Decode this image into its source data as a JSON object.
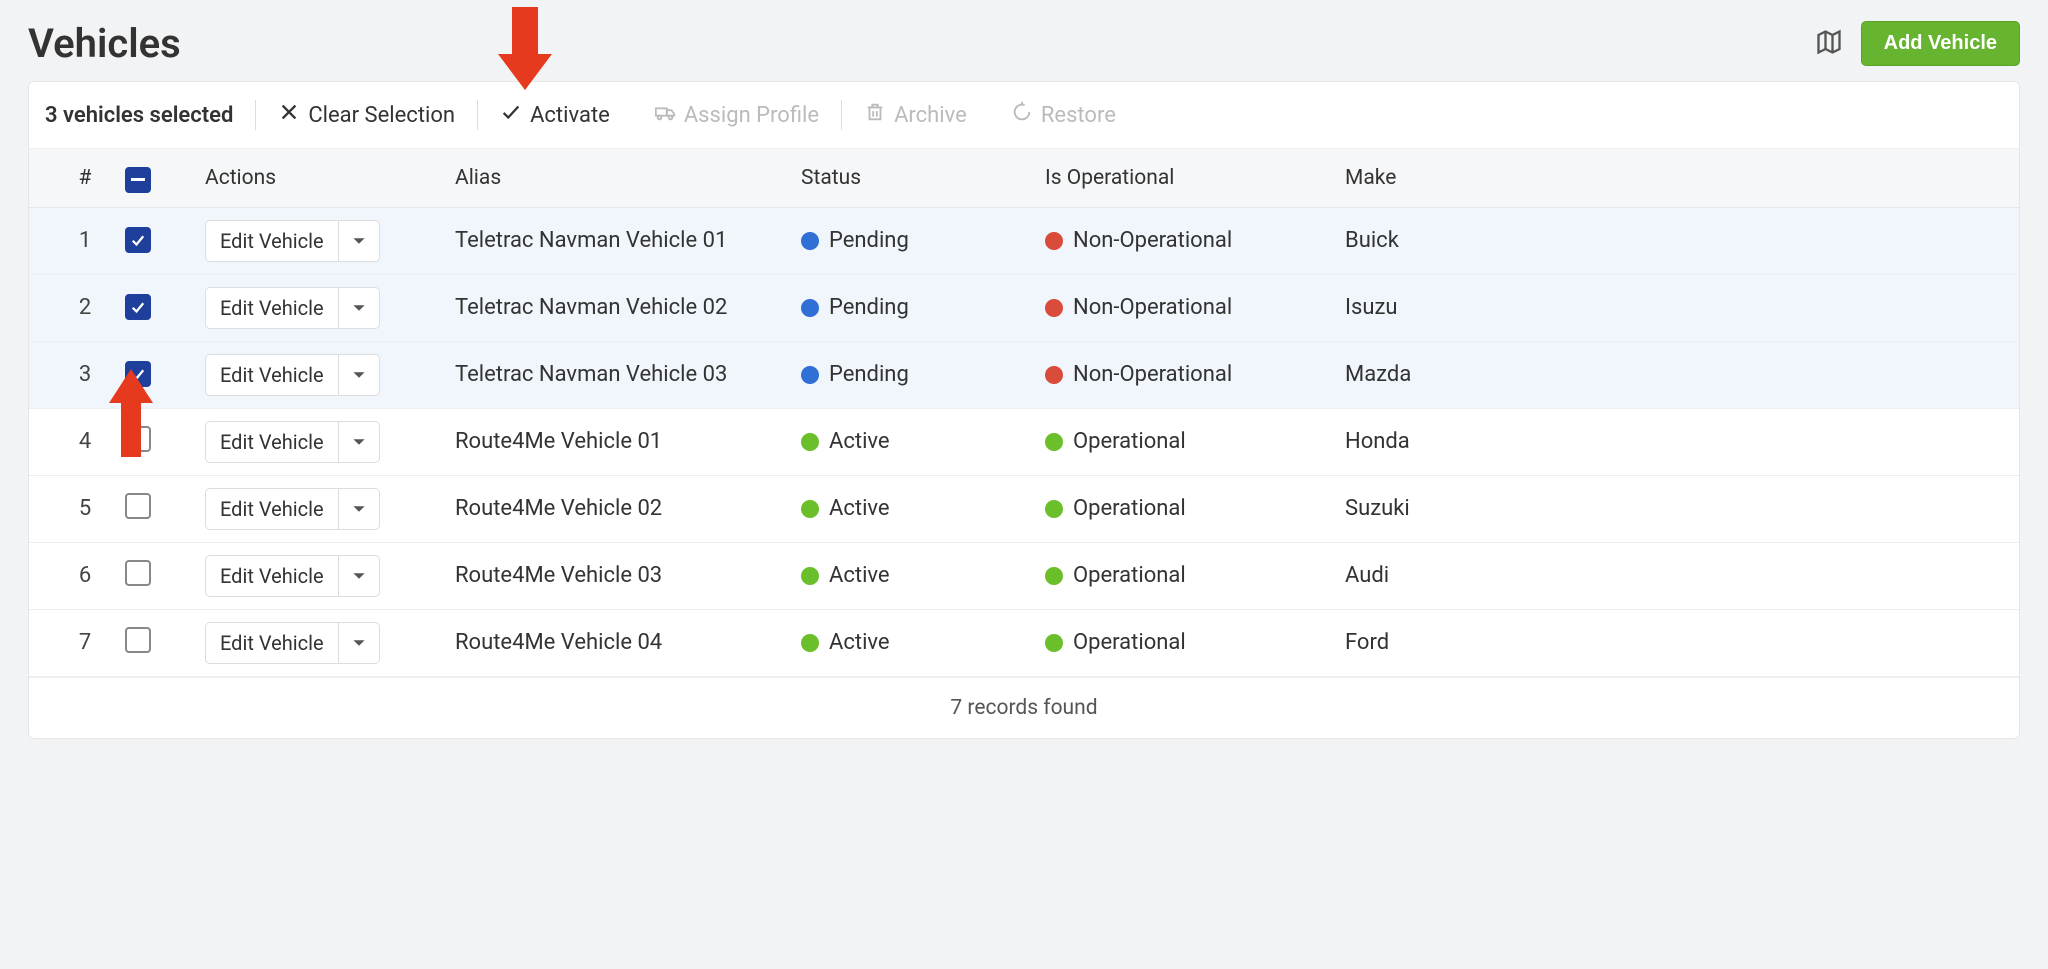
{
  "page": {
    "title": "Vehicles",
    "add_button": "Add Vehicle"
  },
  "toolbar": {
    "selected_text": "3 vehicles selected",
    "clear_label": "Clear Selection",
    "activate_label": "Activate",
    "assign_profile_label": "Assign Profile",
    "archive_label": "Archive",
    "restore_label": "Restore"
  },
  "columns": {
    "num": "#",
    "actions": "Actions",
    "alias": "Alias",
    "status": "Status",
    "operational": "Is Operational",
    "make": "Make"
  },
  "action_button": "Edit Vehicle",
  "rows": [
    {
      "num": "1",
      "checked": true,
      "alias": "Teletrac Navman Vehicle 01",
      "status": "Pending",
      "status_dot": "blue",
      "operational": "Non-Operational",
      "op_dot": "red",
      "make": "Buick"
    },
    {
      "num": "2",
      "checked": true,
      "alias": "Teletrac Navman Vehicle 02",
      "status": "Pending",
      "status_dot": "blue",
      "operational": "Non-Operational",
      "op_dot": "red",
      "make": "Isuzu"
    },
    {
      "num": "3",
      "checked": true,
      "alias": "Teletrac Navman Vehicle 03",
      "status": "Pending",
      "status_dot": "blue",
      "operational": "Non-Operational",
      "op_dot": "red",
      "make": "Mazda"
    },
    {
      "num": "4",
      "checked": false,
      "alias": "Route4Me Vehicle 01",
      "status": "Active",
      "status_dot": "green",
      "operational": "Operational",
      "op_dot": "green",
      "make": "Honda"
    },
    {
      "num": "5",
      "checked": false,
      "alias": "Route4Me Vehicle 02",
      "status": "Active",
      "status_dot": "green",
      "operational": "Operational",
      "op_dot": "green",
      "make": "Suzuki"
    },
    {
      "num": "6",
      "checked": false,
      "alias": "Route4Me Vehicle 03",
      "status": "Active",
      "status_dot": "green",
      "operational": "Operational",
      "op_dot": "green",
      "make": "Audi"
    },
    {
      "num": "7",
      "checked": false,
      "alias": "Route4Me Vehicle 04",
      "status": "Active",
      "status_dot": "green",
      "operational": "Operational",
      "op_dot": "green",
      "make": "Ford"
    }
  ],
  "footer_text": "7 records found"
}
